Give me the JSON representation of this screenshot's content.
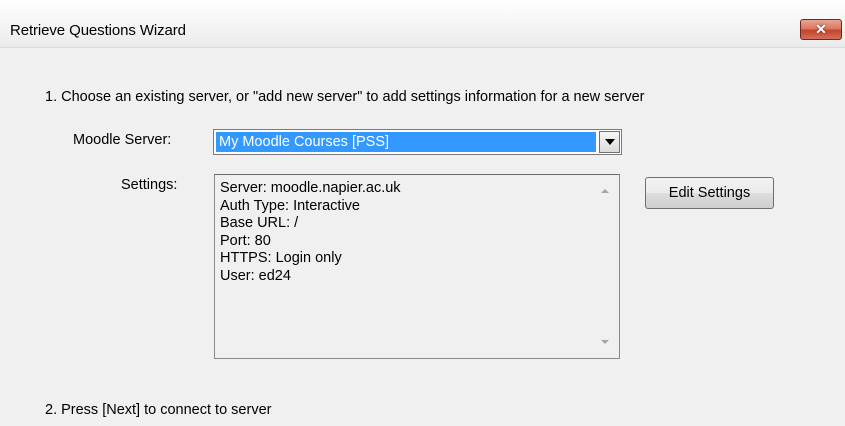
{
  "window": {
    "title": "Retrieve Questions Wizard",
    "close_glyph": "✕",
    "close_icon": "close-icon",
    "close_color": "#c7432a"
  },
  "step1": {
    "text": "1.  Choose an existing server, or \"add new server\" to add settings information for a new server"
  },
  "server": {
    "label": "Moodle Server:",
    "selected": "My Moodle Courses [PSS]",
    "dropdown_icon": "chevron-down-icon",
    "highlight_color": "#3399ff"
  },
  "settings": {
    "label": "Settings:",
    "lines": [
      "Server: moodle.napier.ac.uk",
      "Auth Type: Interactive",
      "Base URL: /",
      "Port: 80",
      "HTTPS: Login only",
      "User: ed24"
    ],
    "edit_button": "Edit Settings"
  },
  "step2": {
    "text": "2.  Press [Next] to connect to server"
  }
}
